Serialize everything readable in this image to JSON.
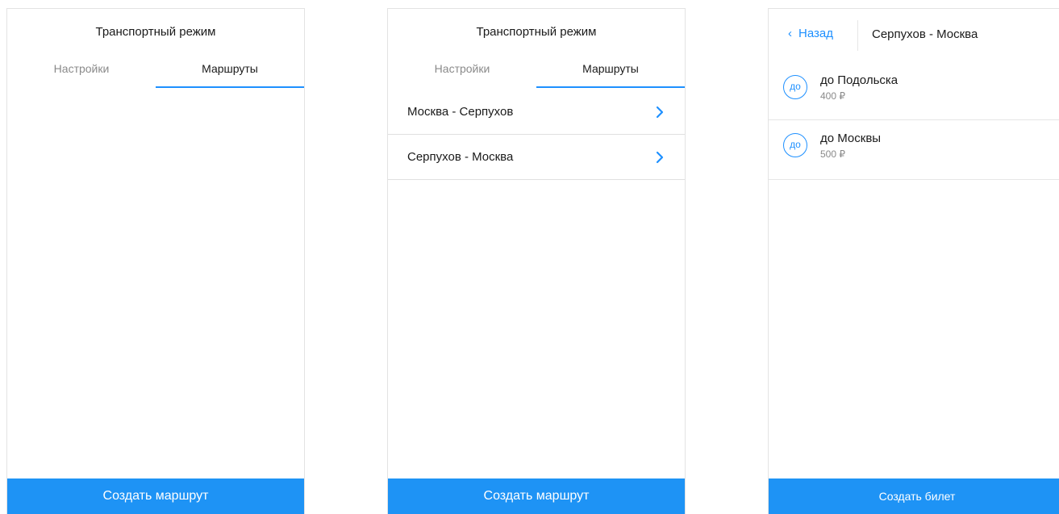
{
  "screen1": {
    "title": "Транспортный режим",
    "tabs": [
      {
        "label": "Настройки",
        "active": false
      },
      {
        "label": "Маршруты",
        "active": true
      }
    ],
    "create_button_label": "Создать маршрут"
  },
  "screen2": {
    "title": "Транспортный режим",
    "tabs": [
      {
        "label": "Настройки",
        "active": false
      },
      {
        "label": "Маршруты",
        "active": true
      }
    ],
    "routes": [
      {
        "label": "Москва - Серпухов",
        "icon": "chevron-right-icon"
      },
      {
        "label": "Серпухов - Москва",
        "icon": "chevron-right-icon"
      }
    ],
    "create_button_label": "Создать маршрут"
  },
  "screen3": {
    "back_label": "Назад",
    "title": "Серпухов - Москва",
    "tickets": [
      {
        "badge": "до",
        "name": "до Подольска",
        "price": "400 ₽"
      },
      {
        "badge": "до",
        "name": "до Москвы",
        "price": "500 ₽"
      }
    ],
    "create_button_label": "Создать билет"
  },
  "colors": {
    "accent": "#1e90ff",
    "button_bg": "#1e93f5",
    "muted_text": "#8a8a8a"
  }
}
